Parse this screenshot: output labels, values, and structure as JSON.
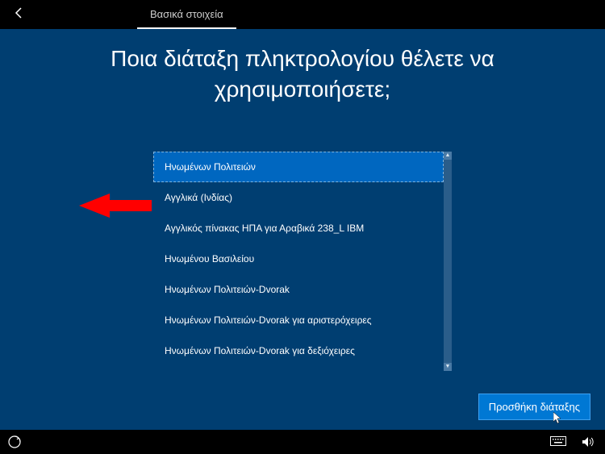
{
  "topbar": {
    "tab_label": "Βασικά στοιχεία"
  },
  "heading": "Ποια διάταξη πληκτρολογίου θέλετε να χρησιμοποιήσετε;",
  "keyboard_layouts": [
    {
      "label": "Ηνωμένων Πολιτειών",
      "selected": true
    },
    {
      "label": "Αγγλικά (Ινδίας)",
      "selected": false
    },
    {
      "label": "Αγγλικός πίνακας ΗΠΑ για Αραβικά 238_L IBM",
      "selected": false
    },
    {
      "label": "Ηνωμένου Βασιλείου",
      "selected": false
    },
    {
      "label": "Ηνωμένων Πολιτειών-Dvorak",
      "selected": false
    },
    {
      "label": "Ηνωμένων Πολιτειών-Dvorak για αριστερόχειρες",
      "selected": false
    },
    {
      "label": "Ηνωμένων Πολιτειών-Dvorak για δεξιόχειρες",
      "selected": false
    }
  ],
  "primary_button": "Προσθήκη διάταξης",
  "colors": {
    "background": "#003e71",
    "accent": "#0078d4",
    "selected": "#0067c0",
    "annotation": "#ff0000"
  }
}
